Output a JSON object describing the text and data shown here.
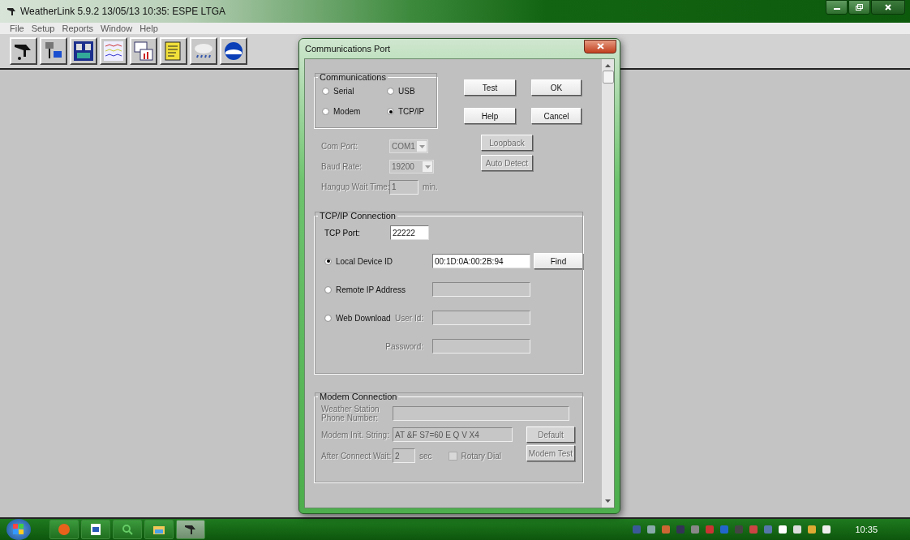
{
  "window": {
    "title": "WeatherLink 5.9.2  13/05/13  10:35: ESPE LTGA"
  },
  "menu": [
    "File",
    "Setup",
    "Reports",
    "Window",
    "Help"
  ],
  "dialog": {
    "title": "Communications Port",
    "communications": {
      "label": "Communications",
      "options": [
        {
          "label": "Serial",
          "selected": false
        },
        {
          "label": "USB",
          "selected": false
        },
        {
          "label": "Modem",
          "selected": false
        },
        {
          "label": "TCP/IP",
          "selected": true
        }
      ]
    },
    "buttons": [
      {
        "label": "Test",
        "disabled": false
      },
      {
        "label": "OK",
        "disabled": false
      },
      {
        "label": "Help",
        "disabled": false
      },
      {
        "label": "Cancel",
        "disabled": false
      }
    ],
    "serial": {
      "com_port": {
        "label": "Com Port:",
        "value": "COM1",
        "disabled": true
      },
      "baud_rate": {
        "label": "Baud Rate:",
        "value": "19200",
        "disabled": true
      },
      "hangup": {
        "label": "Hangup Wait Time:",
        "value": "1",
        "unit": "min.",
        "disabled": true
      },
      "loopback": {
        "label": "Loopback",
        "disabled": true
      },
      "auto_detect": {
        "label": "Auto Detect",
        "disabled": true
      }
    },
    "tcpip": {
      "label": "TCP/IP Connection",
      "port": {
        "label": "TCP Port:",
        "value": "22222"
      },
      "options": [
        {
          "label": "Local Device ID",
          "selected": true,
          "value": "00:1D:0A:00:2B:94"
        },
        {
          "label": "Remote IP Address",
          "selected": false
        },
        {
          "label": "Web Download",
          "selected": false
        }
      ],
      "find": {
        "label": "Find",
        "disabled": false
      },
      "user_id": {
        "label": "User Id:",
        "disabled": true
      },
      "password": {
        "label": "Password:",
        "disabled": true
      }
    },
    "modem": {
      "label": "Modem Connection",
      "phone": {
        "label": "Weather Station Phone Number:",
        "disabled": true
      },
      "init": {
        "label": "Modem Init. String:",
        "value": "AT &F S7=60 E Q V X4",
        "disabled": true
      },
      "wait": {
        "label": "After Connect Wait:",
        "value": "2",
        "unit": "sec",
        "disabled": true
      },
      "rotary": {
        "label": "Rotary Dial",
        "checked": false,
        "disabled": true
      },
      "default_button": {
        "label": "Default",
        "disabled": true
      },
      "test_button": {
        "label": "Modem Test",
        "disabled": true
      }
    }
  },
  "taskbar": {
    "clock": "10:35"
  }
}
